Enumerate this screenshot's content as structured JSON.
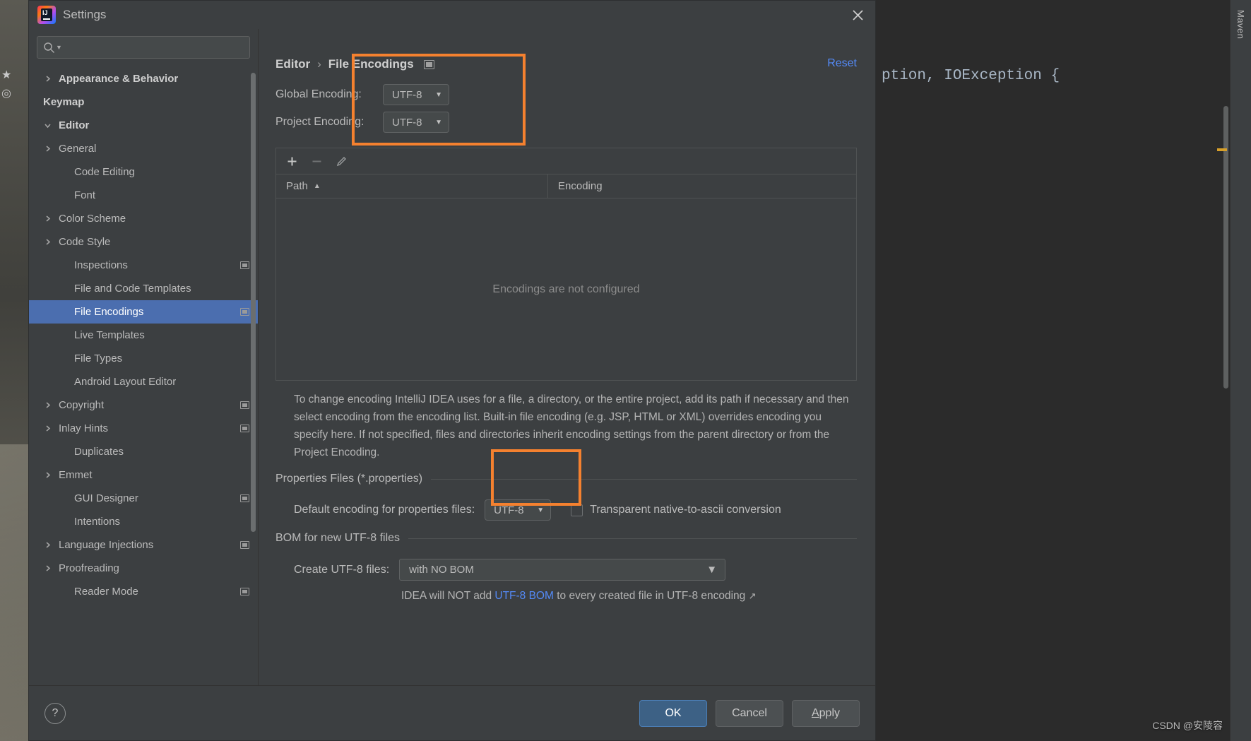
{
  "window": {
    "title": "Settings",
    "logo_icon": "intellij-idea-logo",
    "close_icon": "close-icon"
  },
  "search": {
    "placeholder": "",
    "value": "",
    "icon": "search-icon"
  },
  "sidebar": {
    "items": [
      {
        "label": "Appearance & Behavior",
        "level": 1,
        "arrow": "chevron-right",
        "bold": true,
        "selected": false,
        "badge": false
      },
      {
        "label": "Keymap",
        "level": 1,
        "arrow": "none",
        "bold": true,
        "selected": false,
        "badge": false
      },
      {
        "label": "Editor",
        "level": 1,
        "arrow": "chevron-down",
        "bold": true,
        "selected": false,
        "badge": false
      },
      {
        "label": "General",
        "level": 2,
        "arrow": "chevron-right",
        "bold": false,
        "selected": false,
        "badge": false
      },
      {
        "label": "Code Editing",
        "level": 2,
        "arrow": "none",
        "bold": false,
        "selected": false,
        "badge": false
      },
      {
        "label": "Font",
        "level": 2,
        "arrow": "none",
        "bold": false,
        "selected": false,
        "badge": false
      },
      {
        "label": "Color Scheme",
        "level": 2,
        "arrow": "chevron-right",
        "bold": false,
        "selected": false,
        "badge": false
      },
      {
        "label": "Code Style",
        "level": 2,
        "arrow": "chevron-right",
        "bold": false,
        "selected": false,
        "badge": false
      },
      {
        "label": "Inspections",
        "level": 2,
        "arrow": "none",
        "bold": false,
        "selected": false,
        "badge": true
      },
      {
        "label": "File and Code Templates",
        "level": 2,
        "arrow": "none",
        "bold": false,
        "selected": false,
        "badge": false
      },
      {
        "label": "File Encodings",
        "level": 2,
        "arrow": "none",
        "bold": false,
        "selected": true,
        "badge": true
      },
      {
        "label": "Live Templates",
        "level": 2,
        "arrow": "none",
        "bold": false,
        "selected": false,
        "badge": false
      },
      {
        "label": "File Types",
        "level": 2,
        "arrow": "none",
        "bold": false,
        "selected": false,
        "badge": false
      },
      {
        "label": "Android Layout Editor",
        "level": 2,
        "arrow": "none",
        "bold": false,
        "selected": false,
        "badge": false
      },
      {
        "label": "Copyright",
        "level": 2,
        "arrow": "chevron-right",
        "bold": false,
        "selected": false,
        "badge": true
      },
      {
        "label": "Inlay Hints",
        "level": 2,
        "arrow": "chevron-right",
        "bold": false,
        "selected": false,
        "badge": true
      },
      {
        "label": "Duplicates",
        "level": 2,
        "arrow": "none",
        "bold": false,
        "selected": false,
        "badge": false
      },
      {
        "label": "Emmet",
        "level": 2,
        "arrow": "chevron-right",
        "bold": false,
        "selected": false,
        "badge": false
      },
      {
        "label": "GUI Designer",
        "level": 2,
        "arrow": "none",
        "bold": false,
        "selected": false,
        "badge": true
      },
      {
        "label": "Intentions",
        "level": 2,
        "arrow": "none",
        "bold": false,
        "selected": false,
        "badge": false
      },
      {
        "label": "Language Injections",
        "level": 2,
        "arrow": "chevron-right",
        "bold": false,
        "selected": false,
        "badge": true
      },
      {
        "label": "Proofreading",
        "level": 2,
        "arrow": "chevron-right",
        "bold": false,
        "selected": false,
        "badge": false
      },
      {
        "label": "Reader Mode",
        "level": 2,
        "arrow": "none",
        "bold": false,
        "selected": false,
        "badge": true
      }
    ]
  },
  "main": {
    "breadcrumb": {
      "parent": "Editor",
      "separator": "›",
      "current": "File Encodings",
      "badge_icon": "project-scope-icon"
    },
    "reset_label": "Reset",
    "global_encoding": {
      "label": "Global Encoding:",
      "value": "UTF-8",
      "caret": "▼"
    },
    "project_encoding": {
      "label": "Project Encoding:",
      "value": "UTF-8",
      "caret": "▼"
    },
    "table_toolbar": {
      "add_icon": "plus-icon",
      "remove_icon": "minus-icon",
      "edit_icon": "pencil-icon"
    },
    "table": {
      "columns": [
        "Path",
        "Encoding"
      ],
      "sort_caret": "▲",
      "rows": [],
      "empty_text": "Encodings are not configured"
    },
    "description": "To change encoding IntelliJ IDEA uses for a file, a directory, or the entire project, add its path if necessary and then select encoding from the encoding list. Built-in file encoding (e.g. JSP, HTML or XML) overrides encoding you specify here. If not specified, files and directories inherit encoding settings from the parent directory or from the Project Encoding.",
    "properties_section": {
      "title": "Properties Files (*.properties)",
      "default_encoding_label": "Default encoding for properties files:",
      "default_encoding_value": "UTF-8",
      "caret": "▼",
      "checkbox_label": "Transparent native-to-ascii conversion",
      "checkbox_checked": false
    },
    "bom_section": {
      "title": "BOM for new UTF-8 files",
      "create_label": "Create UTF-8 files:",
      "create_value": "with NO BOM",
      "caret": "▼",
      "note_prefix": "IDEA will NOT add ",
      "note_link": "UTF-8 BOM",
      "note_suffix": " to every created file in UTF-8 encoding",
      "note_external_icon": "↗"
    }
  },
  "footer": {
    "help_icon": "question-mark-icon",
    "ok_label": "OK",
    "cancel_label": "Cancel",
    "apply_label": "Apply",
    "apply_mnemonic": "A",
    "apply_rest": "pply"
  },
  "background": {
    "ide_code_snippet_prefix": "ption, ",
    "ide_code_snippet_class": "IOException",
    "ide_code_snippet_suffix": " {",
    "right_rail_label": "Maven",
    "watermark": "CSDN @安陵容"
  },
  "colors": {
    "accent_highlight": "#f5812f",
    "selection_blue": "#4b6eaf",
    "link_blue": "#548af7",
    "panel_bg": "#3c3f41",
    "primary_button": "#3d6185"
  }
}
